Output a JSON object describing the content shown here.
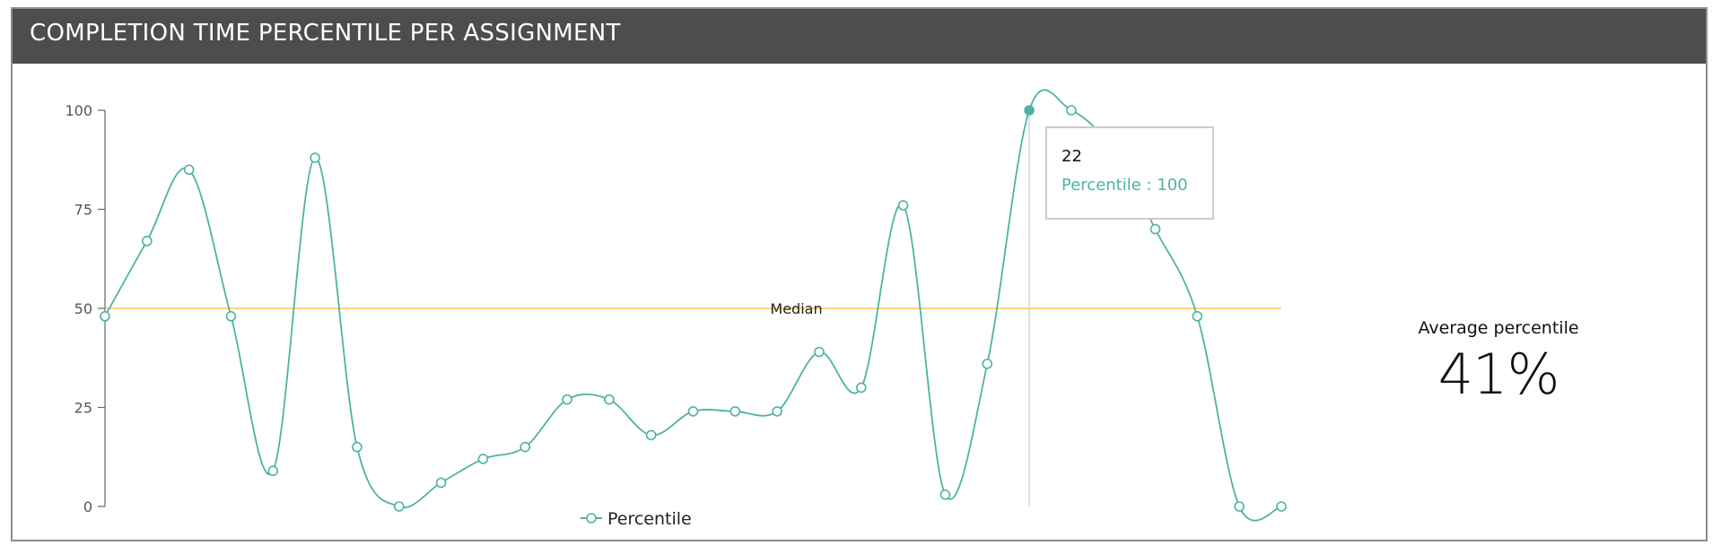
{
  "panel": {
    "title": "COMPLETION TIME PERCENTILE PER ASSIGNMENT"
  },
  "summary": {
    "label": "Average percentile",
    "value": "41%"
  },
  "tooltip": {
    "x_label": "22",
    "text": "Percentile : 100",
    "index": 22
  },
  "colors": {
    "header_bg": "#4d4d4d",
    "series": "#4db3a4",
    "median_line": "#f7c948",
    "axis": "#666666",
    "tooltip_border": "#cccccc"
  },
  "chart_data": {
    "type": "line",
    "title": "",
    "xlabel": "",
    "ylabel": "",
    "ylim": [
      0,
      100
    ],
    "yticks": [
      0,
      25,
      50,
      75,
      100
    ],
    "grid": false,
    "legend_position": "bottom",
    "series": [
      {
        "name": "Percentile",
        "values": [
          48,
          67,
          85,
          48,
          9,
          88,
          15,
          0,
          6,
          12,
          15,
          27,
          27,
          18,
          24,
          24,
          24,
          39,
          30,
          76,
          3,
          36,
          100,
          100,
          90,
          70,
          48,
          0,
          0
        ]
      }
    ],
    "reference_lines": [
      {
        "label": "Median",
        "y": 50
      }
    ]
  }
}
